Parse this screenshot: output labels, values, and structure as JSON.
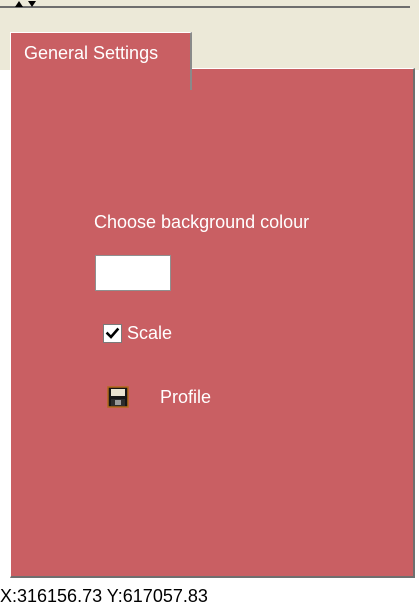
{
  "toolbar": {
    "collapse_icons": [
      "up-arrow-icon",
      "down-arrow-icon"
    ]
  },
  "tabs": [
    {
      "label": "General Settings",
      "active": true
    }
  ],
  "panel": {
    "background_color": "#c95f63",
    "background_label": "Choose background colour",
    "selected_colour": "#ffffff",
    "scale": {
      "label": "Scale",
      "checked": true
    },
    "profile": {
      "label": "Profile",
      "icon": "floppy-disk-icon"
    }
  },
  "status": {
    "coords": "X:316156.73 Y:617057.83"
  }
}
